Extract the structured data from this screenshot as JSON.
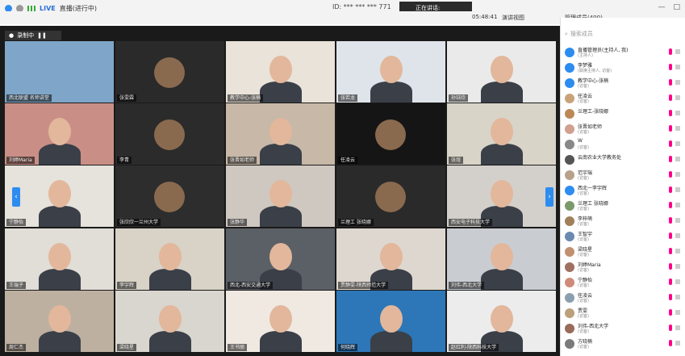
{
  "titlebar": {
    "live_label": "LIVE",
    "meeting_name": "直播(进行中)",
    "meeting_id": "ID: *** *** *** 771",
    "speaking_label": "正在讲话:",
    "timer": "05:48:41",
    "layout_label": "演讲视图",
    "participants_label": "管理成员(400)",
    "min_label": "—",
    "max_label": "□",
    "close_label": "×"
  },
  "toolbar": {
    "record_label": "录制中"
  },
  "search": {
    "placeholder": "搜索成员"
  },
  "tiles": [
    {
      "name": "西北联盟 名师讲堂"
    },
    {
      "name": "张雯霖"
    },
    {
      "name": "教学中心-张楠"
    },
    {
      "name": "张若龙"
    },
    {
      "name": "孙钰欣"
    },
    {
      "name": "刘婷Maria"
    },
    {
      "name": "李青"
    },
    {
      "name": "张晋如老师"
    },
    {
      "name": "任凌云"
    },
    {
      "name": "张煊"
    },
    {
      "name": "宁静怡"
    },
    {
      "name": "张欣欣一兰州大学"
    },
    {
      "name": "张静华"
    },
    {
      "name": "兰理工 张晓娜"
    },
    {
      "name": "西安电子科技大学"
    },
    {
      "name": "王瑞子"
    },
    {
      "name": "李宇辉"
    },
    {
      "name": "西北-西安交通大学"
    },
    {
      "name": "贾静雯-陕西师范大学"
    },
    {
      "name": "刘伟-西北大学"
    },
    {
      "name": "周仁杰"
    },
    {
      "name": "梁晓星"
    },
    {
      "name": "王书丽"
    },
    {
      "name": "何晓辉"
    },
    {
      "name": "赵红利-陕西科技大学"
    }
  ],
  "participants": [
    {
      "name": "直播管理员(主持人, 我)",
      "role": "(主持人)"
    },
    {
      "name": "李梦雅",
      "role": "(联席主持人, 访客)"
    },
    {
      "name": "教学中心-张楠",
      "role": "(访客)"
    },
    {
      "name": "任凌云",
      "role": "(访客)"
    },
    {
      "name": "兰理工-张晓娜",
      "role": ""
    },
    {
      "name": "张晋如老师",
      "role": "(访客)"
    },
    {
      "name": "W",
      "role": "(访客)"
    },
    {
      "name": "云南农业大学教务处",
      "role": ""
    },
    {
      "name": "范宇瑞",
      "role": "(访客)"
    },
    {
      "name": "西北一李宇辉",
      "role": "(访客)"
    },
    {
      "name": "兰理工 张晓娜",
      "role": "(访客)"
    },
    {
      "name": "李梓萌",
      "role": "(访客)"
    },
    {
      "name": "王智宇",
      "role": "(访客)"
    },
    {
      "name": "梁晓星",
      "role": "(访客)"
    },
    {
      "name": "刘婷Maria",
      "role": "(访客)"
    },
    {
      "name": "宁静怡",
      "role": "(访客)"
    },
    {
      "name": "任凌云",
      "role": "(访客)"
    },
    {
      "name": "贾雯",
      "role": "(访客)"
    },
    {
      "name": "刘伟-西北大学",
      "role": "(访客)"
    },
    {
      "name": "方晓楠",
      "role": "(访客)"
    }
  ]
}
